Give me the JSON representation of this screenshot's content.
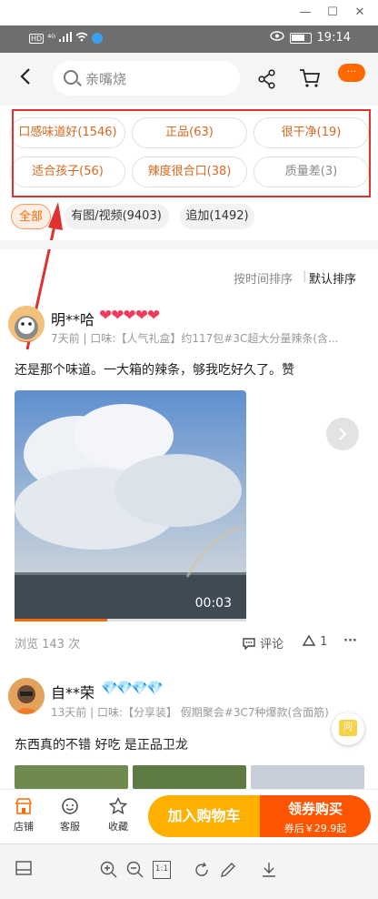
{
  "window": {
    "minimize_glyph": "—",
    "maximize_glyph": "☐",
    "close_glyph": "✕"
  },
  "status_bar": {
    "time": "19:14",
    "network": "HD",
    "signal": "⁴ᴳ"
  },
  "header": {
    "search_placeholder": "亲嘴烧",
    "more_label": "···"
  },
  "tags": [
    {
      "label": "口感味道好(1546)",
      "kind": "positive"
    },
    {
      "label": "正品(63)",
      "kind": "positive"
    },
    {
      "label": "很干净(19)",
      "kind": "positive"
    },
    {
      "label": "适合孩子(56)",
      "kind": "positive"
    },
    {
      "label": "辣度很合口(38)",
      "kind": "positive"
    },
    {
      "label": "质量差(3)",
      "kind": "negative"
    }
  ],
  "filters": [
    {
      "label": "全部",
      "active": true
    },
    {
      "label": "有图/视频(9403)",
      "active": false
    },
    {
      "label": "追加(1492)",
      "active": false
    }
  ],
  "sort": {
    "by_time": "按时间排序",
    "default": "默认排序"
  },
  "reviews": [
    {
      "user": "明**哈",
      "hearts": "❤❤❤❤❤",
      "meta": "7天前 | 口味:【人气礼盒】约117包#3C超大分量辣条(含...",
      "text": "还是那个味道。一大箱的辣条，够我吃好久了。赞",
      "video_duration": "00:03",
      "video_progress": 0.4,
      "views": "浏览 143 次",
      "comment_label": "评论",
      "likes": "1",
      "more": "···"
    },
    {
      "user": "自**荣",
      "diamonds": "💎💎💎💎",
      "meta": "13天前 | 口味:【分享装】 假期聚会#3C7种爆款(含面筋)",
      "text": "东西真的不错  好吃  是正品卫龙"
    }
  ],
  "side_float_label": "问",
  "bottom_bar": {
    "shop": "店铺",
    "service": "客服",
    "favorite": "收藏",
    "add_to_cart": "加入购物车",
    "buy_main": "领券购买",
    "buy_sub": "券后￥29.9起"
  },
  "viewer_toolbar": {
    "ratio": "1:1"
  },
  "colors": {
    "accent": "#ff6a00",
    "tag_positive": "#d5681f",
    "annotation_red": "#e03030"
  }
}
